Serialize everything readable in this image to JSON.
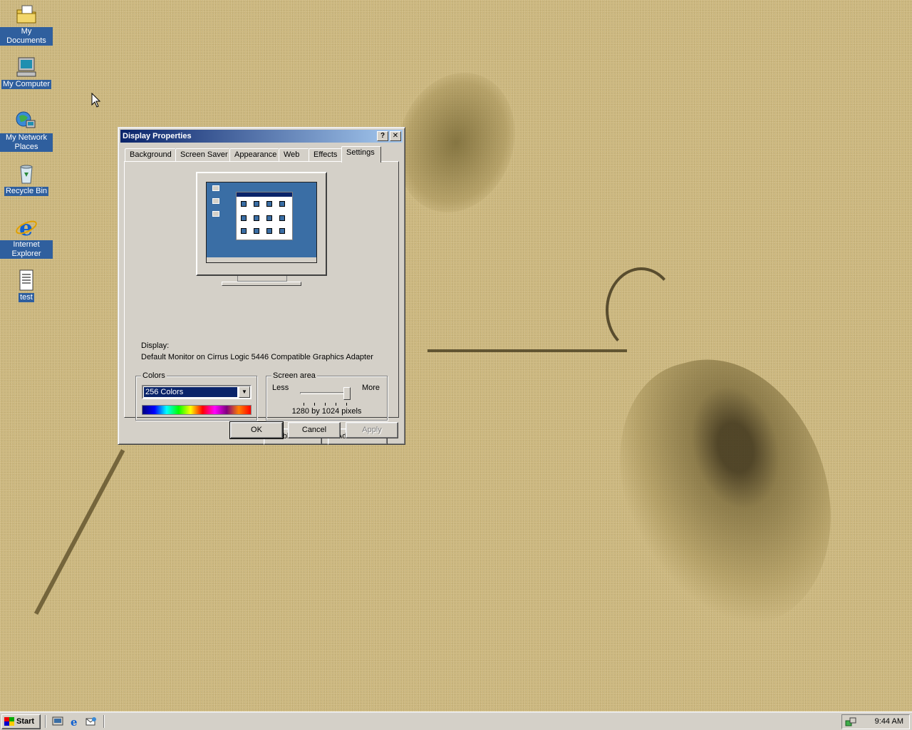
{
  "desktop": {
    "icons": [
      {
        "label": "My Documents",
        "icon": "folder-documents-icon"
      },
      {
        "label": "My Computer",
        "icon": "computer-icon"
      },
      {
        "label": "My Network Places",
        "icon": "network-icon"
      },
      {
        "label": "Recycle Bin",
        "icon": "recycle-bin-icon"
      },
      {
        "label": "Internet Explorer",
        "icon": "internet-explorer-icon"
      },
      {
        "label": "test",
        "icon": "text-document-icon"
      }
    ]
  },
  "dialog": {
    "title": "Display Properties",
    "help_button": "?",
    "close_button": "✕",
    "tabs": [
      "Background",
      "Screen Saver",
      "Appearance",
      "Web",
      "Effects",
      "Settings"
    ],
    "active_tab": "Settings",
    "display_label": "Display:",
    "display_value": "Default Monitor on Cirrus Logic 5446 Compatible Graphics Adapter",
    "colors": {
      "legend": "Colors",
      "selected": "256 Colors"
    },
    "screen_area": {
      "legend": "Screen area",
      "less": "Less",
      "more": "More",
      "resolution": "1280 by 1024 pixels",
      "level": 1.0
    },
    "buttons": {
      "troubleshoot": "Troubleshoot...",
      "advanced": "Advanced...",
      "ok": "OK",
      "cancel": "Cancel",
      "apply": "Apply"
    }
  },
  "taskbar": {
    "start": "Start",
    "quick_launch": [
      "show-desktop-icon",
      "internet-explorer-icon",
      "outlook-express-icon"
    ],
    "clock": "9:44 AM"
  }
}
